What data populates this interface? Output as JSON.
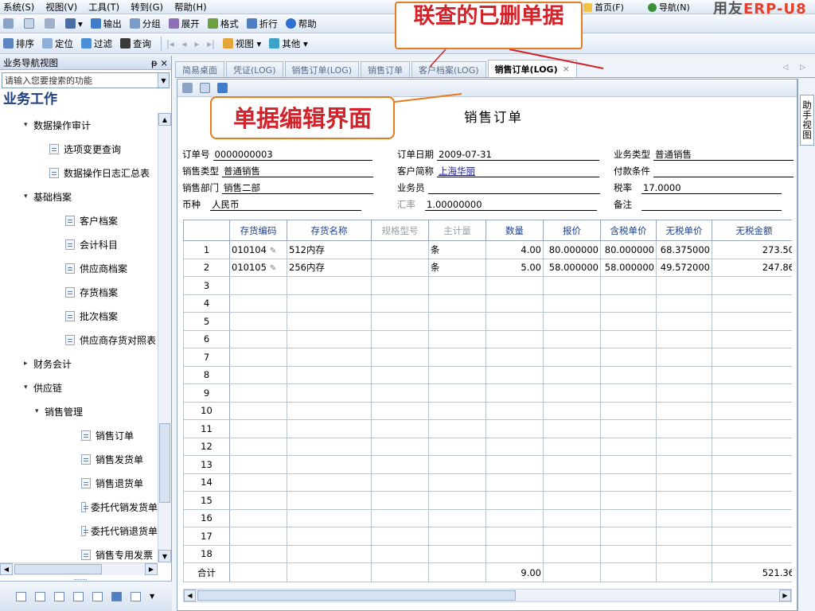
{
  "menubar": {
    "items": [
      "系统(S)",
      "视图(V)",
      "工具(T)",
      "转到(G)",
      "帮助(H)"
    ],
    "home": "首页(F)",
    "nav": "导航(N)",
    "brand_prefix": "用友",
    "brand_erp": "ERP",
    "brand_suffix": "-U8"
  },
  "toolbar1": {
    "output": "输出",
    "group": "分组",
    "expand": "展开",
    "format": "格式",
    "fold": "折行",
    "help": "帮助"
  },
  "toolbar2": {
    "sort": "排序",
    "locate": "定位",
    "filter": "过滤",
    "query": "查询",
    "view": "视图",
    "other": "其他"
  },
  "sidebar": {
    "header": "业务导航视图",
    "pin": "ᵽ ×",
    "search_placeholder": "请输入您要搜索的功能",
    "section_title": "业务工作",
    "tree": [
      {
        "label": "数据操作审计",
        "level": 1,
        "type": "group",
        "expanded": true
      },
      {
        "label": "选项变更查询",
        "level": 2,
        "type": "item"
      },
      {
        "label": "数据操作日志汇总表",
        "level": 2,
        "type": "item"
      },
      {
        "label": "基础档案",
        "level": 1,
        "type": "group",
        "expanded": true
      },
      {
        "label": "客户档案",
        "level": 3,
        "type": "item"
      },
      {
        "label": "会计科目",
        "level": 3,
        "type": "item"
      },
      {
        "label": "供应商档案",
        "level": 3,
        "type": "item"
      },
      {
        "label": "存货档案",
        "level": 3,
        "type": "item"
      },
      {
        "label": "批次档案",
        "level": 3,
        "type": "item"
      },
      {
        "label": "供应商存货对照表",
        "level": 3,
        "type": "item"
      },
      {
        "label": "财务会计",
        "level": 1,
        "type": "group",
        "expanded": false
      },
      {
        "label": "供应链",
        "level": 1,
        "type": "group",
        "expanded": true
      },
      {
        "label": "销售管理",
        "level": 2,
        "type": "group",
        "expanded": true
      },
      {
        "label": "销售订单",
        "level": 4,
        "type": "item"
      },
      {
        "label": "销售发货单",
        "level": 4,
        "type": "item"
      },
      {
        "label": "销售退货单",
        "level": 4,
        "type": "item"
      },
      {
        "label": "委托代销发货单",
        "level": 4,
        "type": "item"
      },
      {
        "label": "委托代销退货单",
        "level": 4,
        "type": "item"
      },
      {
        "label": "销售专用发票",
        "level": 4,
        "type": "item"
      }
    ],
    "splitter": "........."
  },
  "tabs": [
    {
      "label": "简易桌面",
      "active": false
    },
    {
      "label": "凭证(LOG)",
      "active": false
    },
    {
      "label": "销售订单(LOG)",
      "active": false
    },
    {
      "label": "销售订单",
      "active": false
    },
    {
      "label": "客户档案(LOG)",
      "active": false
    },
    {
      "label": "销售订单(LOG)",
      "active": true,
      "closable": "×"
    }
  ],
  "tab_scroll": "◁ ▷",
  "helper_label": "助手视图",
  "document": {
    "title": "销售订单",
    "fields": {
      "order_no": {
        "label": "订单号",
        "value": "0000000003"
      },
      "order_date": {
        "label": "订单日期",
        "value": "2009-07-31"
      },
      "biz_type": {
        "label": "业务类型",
        "value": "普通销售"
      },
      "sale_type": {
        "label": "销售类型",
        "value": "普通销售"
      },
      "customer": {
        "label": "客户简称",
        "value": "上海华丽"
      },
      "pay_terms": {
        "label": "付款条件",
        "value": ""
      },
      "dept": {
        "label": "销售部门",
        "value": "销售二部"
      },
      "salesman": {
        "label": "业务员",
        "value": ""
      },
      "tax_rate": {
        "label": "税率",
        "value": "17.0000"
      },
      "currency": {
        "label": "币种",
        "value": "人民币"
      },
      "exch_rate": {
        "label": "汇率",
        "value": "1.00000000"
      },
      "remark": {
        "label": "备注",
        "value": ""
      }
    },
    "columns": [
      "",
      "存货编码",
      "存货名称",
      "规格型号",
      "主计量",
      "数量",
      "报价",
      "含税单价",
      "无税单价",
      "无税金额"
    ],
    "rows": [
      {
        "no": "1",
        "code": "010104",
        "name": "512内存",
        "spec": "",
        "unit": "条",
        "qty": "4.00",
        "quote": "80.000000",
        "tax_price": "80.000000",
        "notax_price": "68.375000",
        "amount": "273.50"
      },
      {
        "no": "2",
        "code": "010105",
        "name": "256内存",
        "spec": "",
        "unit": "条",
        "qty": "5.00",
        "quote": "58.000000",
        "tax_price": "58.000000",
        "notax_price": "49.572000",
        "amount": "247.86"
      }
    ],
    "empty_row_numbers": [
      "3",
      "4",
      "5",
      "6",
      "7",
      "8",
      "9",
      "10",
      "11",
      "12",
      "13",
      "14",
      "15",
      "16",
      "17",
      "18"
    ],
    "total": {
      "label": "合计",
      "qty": "9.00",
      "amount": "521.36"
    }
  },
  "annotations": {
    "linked_deleted": "联查的已删单据",
    "editor": "单据编辑界面",
    "color": "#d2222a",
    "border_color": "#e57a1e"
  },
  "colors": {
    "header_text": "#1c3f8c",
    "accent": "#e5412a"
  }
}
